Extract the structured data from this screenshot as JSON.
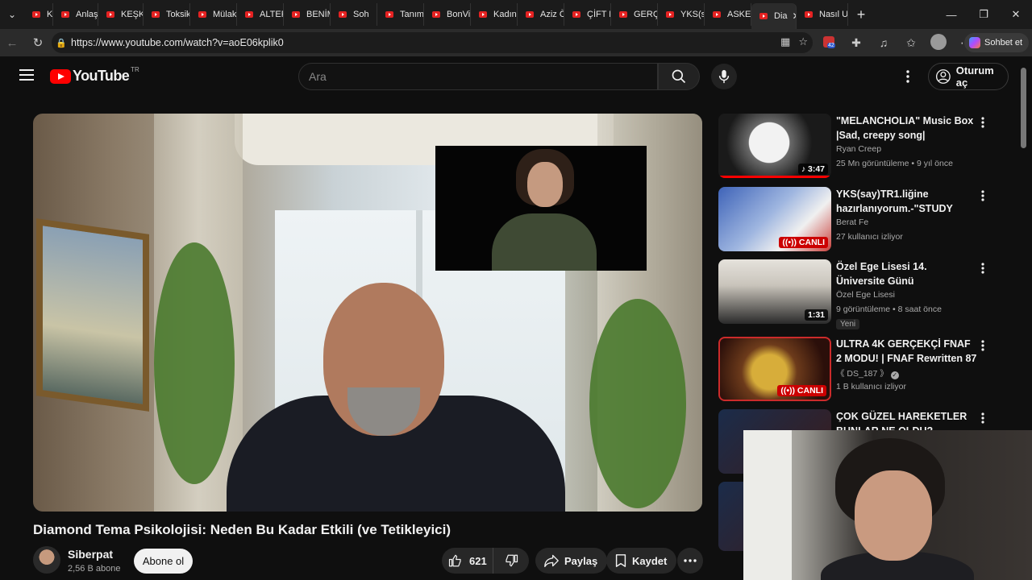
{
  "browser": {
    "tabs": [
      {
        "label": "KO"
      },
      {
        "label": "Anlaşıl"
      },
      {
        "label": "KEŞKE"
      },
      {
        "label": "Toksik"
      },
      {
        "label": "Mülaka"
      },
      {
        "label": "ALTER"
      },
      {
        "label": "BENİM"
      },
      {
        "label": "Soh"
      },
      {
        "label": "Tanıma"
      },
      {
        "label": "BonViv"
      },
      {
        "label": "Kadın y"
      },
      {
        "label": "Aziz Öl"
      },
      {
        "label": "ÇİFT PA"
      },
      {
        "label": "GERÇE"
      },
      {
        "label": "YKS(sa"
      },
      {
        "label": "ASKER"
      },
      {
        "label": "Dia"
      },
      {
        "label": "Nasıl U"
      }
    ],
    "url": "https://www.youtube.com/watch?v=aoE06kplik0",
    "notification_count": "42",
    "copilot_label": "Sohbet et"
  },
  "youtube": {
    "logo_text": "YouTube",
    "country": "TR",
    "search_placeholder": "Ara",
    "signin_label": "Oturum aç"
  },
  "video": {
    "title": "Diamond Tema Psikolojisi: Neden Bu Kadar Etkili (ve Tetikleyici)",
    "channel": "Siberpat",
    "subscribers": "2,56 B abone",
    "subscribe_label": "Abone ol",
    "likes": "621",
    "share_label": "Paylaş",
    "save_label": "Kaydet"
  },
  "recommendations": [
    {
      "title": "\"MELANCHOLIA\" Music Box |Sad, creepy song|",
      "channel": "Ryan Creep",
      "meta": "25 Mn görüntüleme • 9 yıl önce",
      "badge": "♪ 3:47",
      "verified": false,
      "live": false,
      "watched": 1.0
    },
    {
      "title": "YKS(say)TR1.liğine hazırlanıyorum.-\"STUDY WITH ...",
      "channel": "Berat Fe",
      "meta": "27 kullanıcı izliyor",
      "badge": "((•)) CANLI",
      "verified": false,
      "live": true
    },
    {
      "title": "Özel Ege Lisesi 14. Üniversite Günü",
      "channel": "Özel Ege Lisesi",
      "meta": "9 görüntüleme • 8 saat önce",
      "badge": "1:31",
      "tag": "Yeni",
      "verified": false,
      "live": false
    },
    {
      "title": "ULTRA 4K GERÇEKÇİ FNAF 2 MODU! | FNAF Rewritten 87 ...",
      "channel": "《 DS_187 》",
      "meta": "1 B kullanıcı izliyor",
      "badge": "((•)) CANLI",
      "verified": true,
      "live": true
    },
    {
      "title": "ÇOK GÜZEL HAREKETLER BUNLAR NE OLDU?",
      "channel": "",
      "meta": "",
      "badge": "",
      "verified": false,
      "live": false
    }
  ],
  "colors": {
    "background": "#0f0f0f",
    "brand_red": "#ff0000",
    "live_red": "#cc0000",
    "text_primary": "#f1f1f1",
    "text_secondary": "#aaaaaa"
  }
}
